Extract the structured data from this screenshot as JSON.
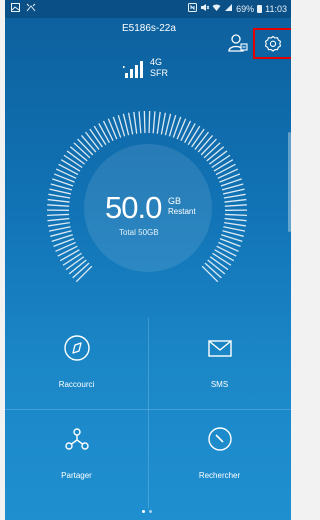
{
  "status_bar": {
    "left_icons": [
      "image-icon",
      "wifi-direct-icon"
    ],
    "right_icons": [
      "nfc-icon",
      "mute-icon",
      "wifi-icon",
      "signal-icon"
    ],
    "battery": "69%",
    "time": "11:03"
  },
  "header": {
    "device_name": "E5186s-22a",
    "user_icon": "users-icon",
    "settings_icon": "gear-icon",
    "highlight_color": "#e00000"
  },
  "network": {
    "type": "4G",
    "operator": "SFR"
  },
  "data_usage": {
    "value": "50.0",
    "unit": "GB",
    "remaining_label": "Restant",
    "total_label": "Total 50GB",
    "remaining_fraction": 1.0
  },
  "shortcuts": [
    {
      "label": "Raccourci",
      "icon": "compass-icon"
    },
    {
      "label": "SMS",
      "icon": "envelope-icon"
    },
    {
      "label": "Partager",
      "icon": "share-icon"
    },
    {
      "label": "Rechercher",
      "icon": "search-icon"
    }
  ],
  "pager": {
    "pages": 2,
    "active": 0
  },
  "colors": {
    "background": "#1173b5",
    "accent": "#ffffff"
  }
}
